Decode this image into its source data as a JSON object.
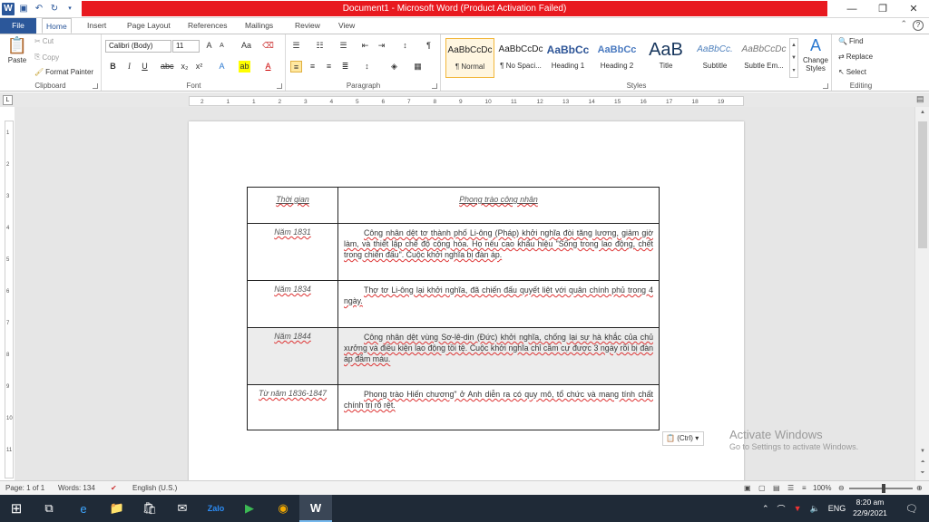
{
  "title": "Document1 - Microsoft Word (Product Activation Failed)",
  "tabs": [
    "File",
    "Home",
    "Insert",
    "Page Layout",
    "References",
    "Mailings",
    "Review",
    "View"
  ],
  "clipboard": {
    "paste": "Paste",
    "cut": "Cut",
    "copy": "Copy",
    "format_painter": "Format Painter",
    "label": "Clipboard"
  },
  "font": {
    "name": "Calibri (Body)",
    "size": "11",
    "label": "Font"
  },
  "paragraph": {
    "label": "Paragraph"
  },
  "styles": {
    "label": "Styles",
    "items": [
      {
        "preview": "AaBbCcDc",
        "name": "¶ Normal"
      },
      {
        "preview": "AaBbCcDc",
        "name": "¶ No Spaci..."
      },
      {
        "preview": "AaBbCc",
        "name": "Heading 1"
      },
      {
        "preview": "AaBbCc",
        "name": "Heading 2"
      },
      {
        "preview": "AaB",
        "name": "Title"
      },
      {
        "preview": "AaBbCc.",
        "name": "Subtitle"
      },
      {
        "preview": "AaBbCcDc",
        "name": "Subtle Em..."
      }
    ],
    "change_styles": "Change Styles"
  },
  "editing": {
    "find": "Find",
    "replace": "Replace",
    "select": "Select",
    "label": "Editing"
  },
  "ruler_ticks": [
    "2",
    "1",
    "1",
    "2",
    "3",
    "4",
    "5",
    "6",
    "7",
    "8",
    "9",
    "10",
    "11",
    "12",
    "13",
    "14",
    "15",
    "16",
    "17",
    "18",
    "19"
  ],
  "vruler_ticks": [
    "1",
    "2",
    "3",
    "4",
    "5",
    "6",
    "7",
    "8",
    "9",
    "10",
    "11"
  ],
  "table": {
    "header": {
      "time": "Thời gian",
      "movement": "Phong trào công nhân"
    },
    "rows": [
      {
        "time": "Năm 1831",
        "text": "Công nhân dệt tơ thành phố Li-ông (Pháp) khởi nghĩa đòi tăng lương, giảm giờ làm, và thiết lập chế độ cộng hòa. Họ nêu cao khẩu hiệu \"Sống trong lao động, chết trong chiến đấu\". Cuộc khởi nghĩa bị đàn áp."
      },
      {
        "time": "Năm 1834",
        "text": "Thợ tơ Li-ông lại khởi nghĩa, đã chiến đấu quyết liệt với quân chính phủ trong 4 ngày."
      },
      {
        "time": "Năm 1844",
        "text": "Công nhân dệt vùng Sơ-lê-din (Đức) khởi nghĩa, chống lại sự hà khắc của chủ xưởng và điều kiện lao động tồi tệ. Cuộc khởi nghĩa chỉ cầm cự được 3 ngày rồi bị đàn áp đẫm máu."
      },
      {
        "time": "Từ năm 1836-1847",
        "text": "Phong trào Hiến chương\" ở Anh diễn ra có quy mô, tổ chức và mang tính chất chính trị rõ rệt."
      }
    ]
  },
  "paste_options": "(Ctrl)",
  "activate": {
    "line1": "Activate Windows",
    "line2": "Go to Settings to activate Windows."
  },
  "status": {
    "page": "Page: 1 of 1",
    "words": "Words: 134",
    "lang": "English (U.S.)",
    "zoom": "100%"
  },
  "taskbar": {
    "lang": "ENG",
    "time": "8:20 am",
    "date": "22/9/2021"
  }
}
